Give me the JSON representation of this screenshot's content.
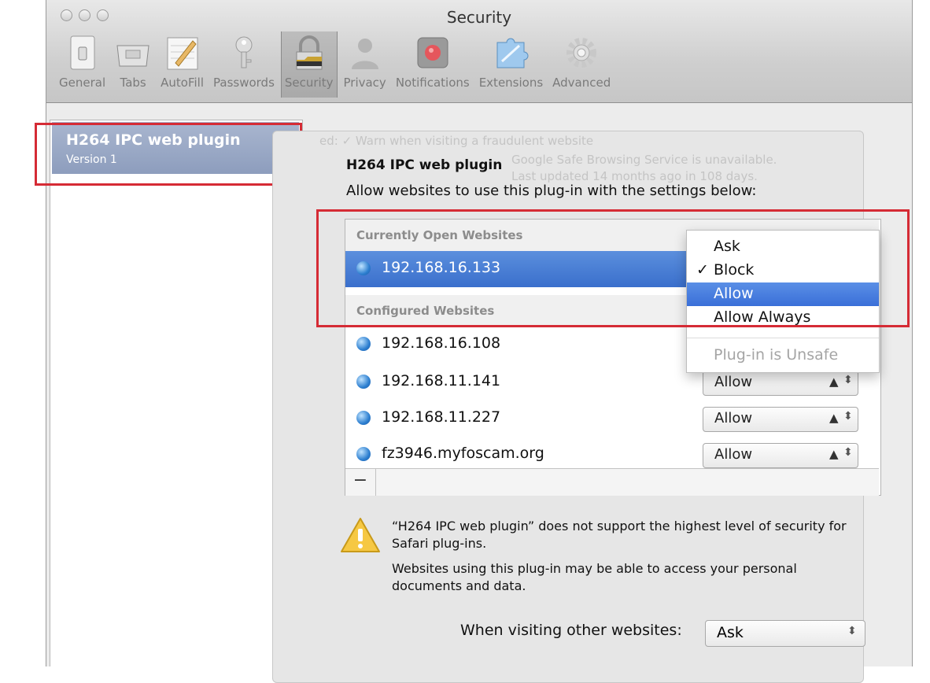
{
  "window": {
    "title": "Security"
  },
  "toolbar": {
    "items": [
      {
        "label": "General",
        "icon": "general-switch-icon"
      },
      {
        "label": "Tabs",
        "icon": "tabs-icon"
      },
      {
        "label": "AutoFill",
        "icon": "autofill-pencil-icon"
      },
      {
        "label": "Passwords",
        "icon": "key-icon"
      },
      {
        "label": "Security",
        "icon": "padlock-icon",
        "selected": true
      },
      {
        "label": "Privacy",
        "icon": "person-silhouette-icon"
      },
      {
        "label": "Notifications",
        "icon": "notifications-icon"
      },
      {
        "label": "Extensions",
        "icon": "puzzle-icon"
      },
      {
        "label": "Advanced",
        "icon": "gear-icon"
      }
    ]
  },
  "sidebar": {
    "plugin": {
      "name": "H264 IPC web plugin",
      "version": "Version 1"
    }
  },
  "background_text": {
    "fraudulent": "ed:  ✓ Warn when visiting a fraudulent website",
    "safe_browsing": "Google Safe Browsing Service is unavailable.",
    "updated": "Last updated 14 months ago in 108 days."
  },
  "header": {
    "title": "H264 IPC web plugin",
    "subtitle": "Allow websites to use this plug-in with the settings below:"
  },
  "sites": {
    "open_header": "Currently Open Websites",
    "configured_header": "Configured Websites",
    "open": [
      {
        "name": "192.168.16.133"
      }
    ],
    "configured": [
      {
        "name": "192.168.16.108",
        "setting": "Allow"
      },
      {
        "name": "192.168.11.141",
        "setting": "Allow"
      },
      {
        "name": "192.168.11.227",
        "setting": "Allow"
      },
      {
        "name": "fz3946.myfoscam.org",
        "setting": "Allow"
      }
    ],
    "remove_button": "−"
  },
  "menu": {
    "items": [
      "Ask",
      "Block",
      "Allow",
      "Allow Always"
    ],
    "checked": "Block",
    "highlighted": "Allow",
    "disabled_item": "Plug-in is Unsafe"
  },
  "warning": {
    "line1": "“H264 IPC web plugin” does not support the highest level of security for Safari plug-ins.",
    "line2": "Websites using this plug-in may be able to access your personal documents and data."
  },
  "other": {
    "label": "When visiting other websites:",
    "value": "Ask"
  },
  "colors": {
    "highlight_red": "#d52b35",
    "selection_blue": "#3a6fcc",
    "sidebar_selected": "#9aa9c6"
  }
}
